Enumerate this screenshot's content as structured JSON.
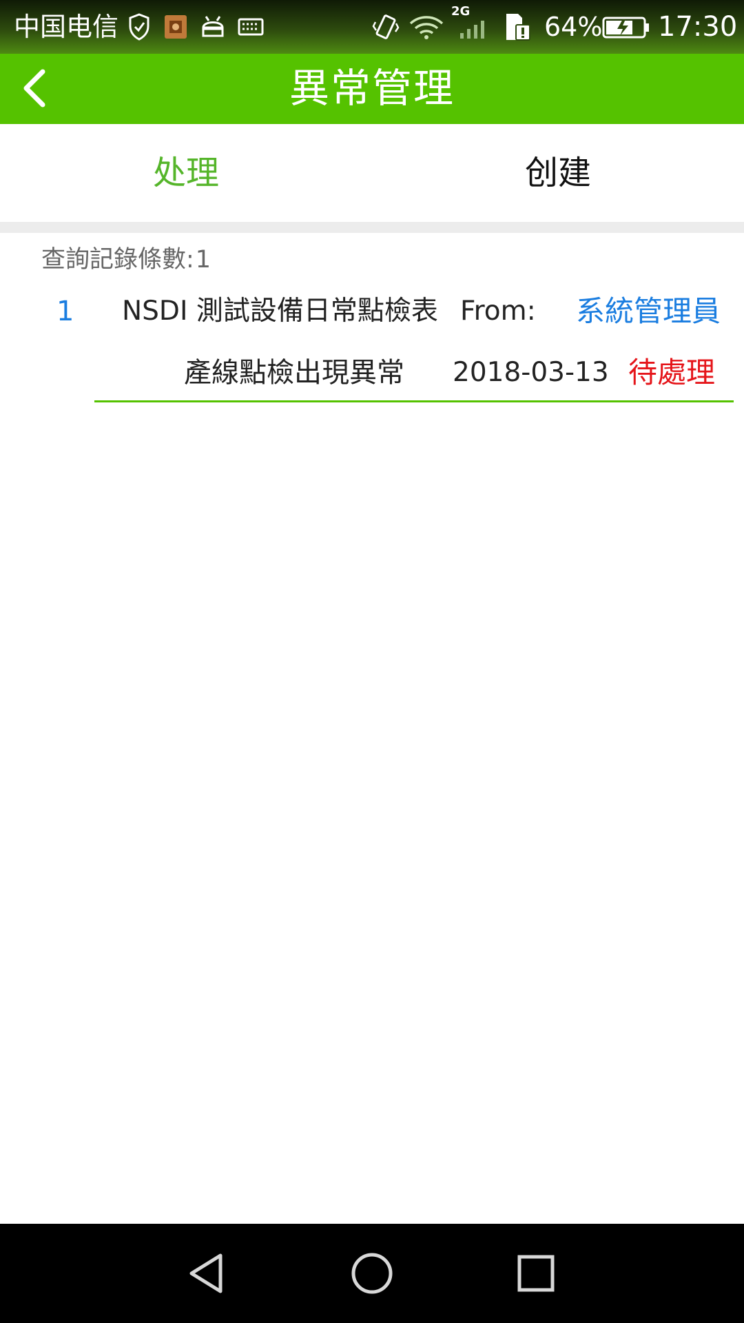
{
  "status_bar": {
    "carrier": "中国电信",
    "network_type": "2G",
    "battery_percent": "64%",
    "time": "17:30",
    "icons": [
      "shield-check-icon",
      "app-notification-icon",
      "android-icon",
      "keyboard-icon",
      "vibrate-icon",
      "wifi-icon",
      "signal-icon",
      "sim-alert-icon",
      "battery-charging-icon"
    ]
  },
  "header": {
    "title": "異常管理",
    "back_icon": "chevron-left-icon"
  },
  "tabs": [
    {
      "label": "处理",
      "active": true
    },
    {
      "label": "创建",
      "active": false
    }
  ],
  "list": {
    "count_label": "查詢記錄條數:",
    "count_value": "1",
    "items": [
      {
        "index": "1",
        "title": "NSDI 測試設備日常點檢表",
        "from_label": "From:",
        "sender": "系統管理員",
        "description": "產線點檢出現異常",
        "date": "2018-03-13",
        "status": "待處理"
      }
    ]
  },
  "nav_bar": {
    "buttons": [
      "back-triangle-icon",
      "home-circle-icon",
      "recents-square-icon"
    ]
  },
  "colors": {
    "primary_green": "#55c200",
    "active_tab": "#55b52a",
    "link_blue": "#1a7de0",
    "status_red": "#e5151a"
  }
}
